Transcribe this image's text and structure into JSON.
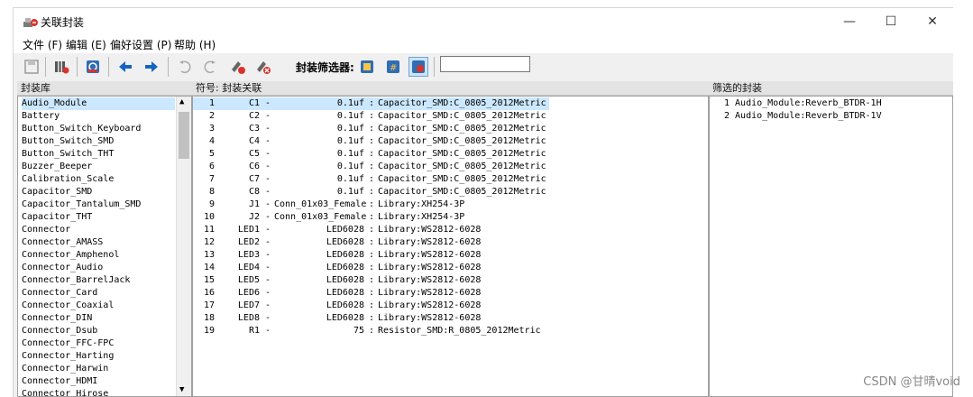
{
  "window": {
    "title": "关联封装",
    "minimize": "—",
    "maximize": "☐",
    "close": "✕"
  },
  "menu": [
    {
      "label": "文件 (F)"
    },
    {
      "label": "编辑 (E)"
    },
    {
      "label": "偏好设置 (P)"
    },
    {
      "label": "帮助 (H)"
    }
  ],
  "toolbar": {
    "filter_label": "封装筛选器:",
    "filter_value": "",
    "icons": [
      "save-icon",
      "library-icon",
      "refresh-icon",
      "arrow-left-icon",
      "arrow-right-icon",
      "undo-icon",
      "redo-icon",
      "auto-assign-icon",
      "delete-assoc-icon",
      "filter-keyword-icon",
      "filter-pin-count-icon",
      "filter-library-icon"
    ]
  },
  "libraries": {
    "header": "封装库",
    "items": [
      "Audio_Module",
      "Battery",
      "Button_Switch_Keyboard",
      "Button_Switch_SMD",
      "Button_Switch_THT",
      "Buzzer_Beeper",
      "Calibration_Scale",
      "Capacitor_SMD",
      "Capacitor_Tantalum_SMD",
      "Capacitor_THT",
      "Connector",
      "Connector_AMASS",
      "Connector_Amphenol",
      "Connector_Audio",
      "Connector_BarrelJack",
      "Connector_Card",
      "Connector_Coaxial",
      "Connector_DIN",
      "Connector_Dsub",
      "Connector_FFC-FPC",
      "Connector_Harting",
      "Connector_Harwin",
      "Connector_HDMI",
      "Connector_Hirose"
    ],
    "selected_index": 0
  },
  "symbols": {
    "header": "符号: 封装关联",
    "rows": [
      {
        "num": "1",
        "ref": "C1",
        "value": "0.1uf",
        "footprint": "Capacitor_SMD:C_0805_2012Metric"
      },
      {
        "num": "2",
        "ref": "C2",
        "value": "0.1uf",
        "footprint": "Capacitor_SMD:C_0805_2012Metric"
      },
      {
        "num": "3",
        "ref": "C3",
        "value": "0.1uf",
        "footprint": "Capacitor_SMD:C_0805_2012Metric"
      },
      {
        "num": "4",
        "ref": "C4",
        "value": "0.1uf",
        "footprint": "Capacitor_SMD:C_0805_2012Metric"
      },
      {
        "num": "5",
        "ref": "C5",
        "value": "0.1uf",
        "footprint": "Capacitor_SMD:C_0805_2012Metric"
      },
      {
        "num": "6",
        "ref": "C6",
        "value": "0.1uf",
        "footprint": "Capacitor_SMD:C_0805_2012Metric"
      },
      {
        "num": "7",
        "ref": "C7",
        "value": "0.1uf",
        "footprint": "Capacitor_SMD:C_0805_2012Metric"
      },
      {
        "num": "8",
        "ref": "C8",
        "value": "0.1uf",
        "footprint": "Capacitor_SMD:C_0805_2012Metric"
      },
      {
        "num": "9",
        "ref": "J1",
        "value": "Conn_01x03_Female",
        "footprint": "Library:XH254-3P"
      },
      {
        "num": "10",
        "ref": "J2",
        "value": "Conn_01x03_Female",
        "footprint": "Library:XH254-3P"
      },
      {
        "num": "11",
        "ref": "LED1",
        "value": "LED6028",
        "footprint": "Library:WS2812-6028"
      },
      {
        "num": "12",
        "ref": "LED2",
        "value": "LED6028",
        "footprint": "Library:WS2812-6028"
      },
      {
        "num": "13",
        "ref": "LED3",
        "value": "LED6028",
        "footprint": "Library:WS2812-6028"
      },
      {
        "num": "14",
        "ref": "LED4",
        "value": "LED6028",
        "footprint": "Library:WS2812-6028"
      },
      {
        "num": "15",
        "ref": "LED5",
        "value": "LED6028",
        "footprint": "Library:WS2812-6028"
      },
      {
        "num": "16",
        "ref": "LED6",
        "value": "LED6028",
        "footprint": "Library:WS2812-6028"
      },
      {
        "num": "17",
        "ref": "LED7",
        "value": "LED6028",
        "footprint": "Library:WS2812-6028"
      },
      {
        "num": "18",
        "ref": "LED8",
        "value": "LED6028",
        "footprint": "Library:WS2812-6028"
      },
      {
        "num": "19",
        "ref": "R1",
        "value": "75",
        "footprint": "Resistor_SMD:R_0805_2012Metric"
      }
    ],
    "selected_index": 0
  },
  "filtered": {
    "header": "筛选的封装",
    "items": [
      "1 Audio_Module:Reverb_BTDR-1H",
      "2 Audio_Module:Reverb_BTDR-1V"
    ]
  },
  "watermark": "CSDN @甘晴void"
}
